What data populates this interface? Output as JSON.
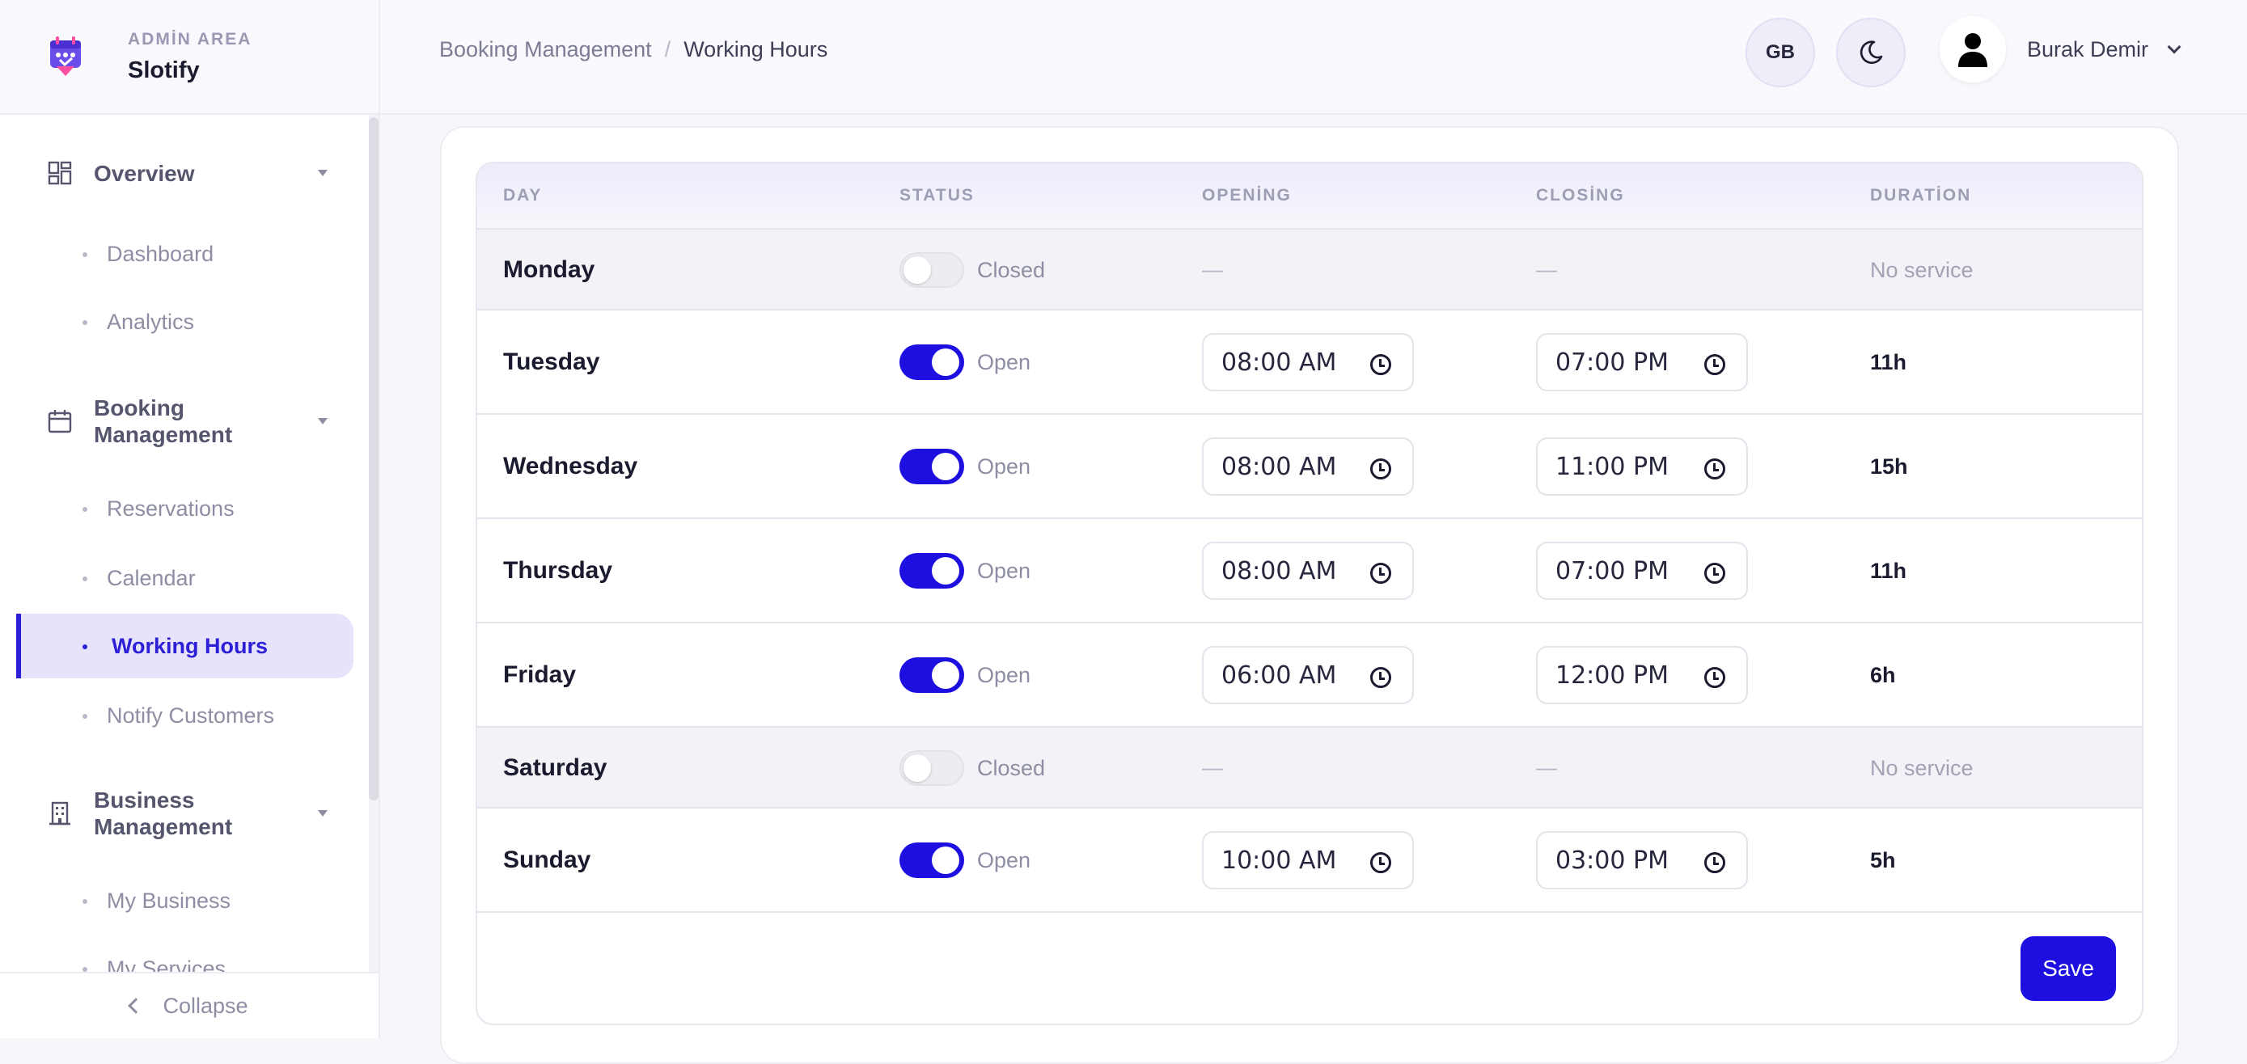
{
  "brand": {
    "area_label": "ADMİN AREA",
    "app_name": "Slotify"
  },
  "sidebar": {
    "groups": [
      {
        "label": "Overview",
        "items": [
          "Dashboard",
          "Analytics"
        ]
      },
      {
        "label": "Booking Management",
        "items": [
          "Reservations",
          "Calendar",
          "Working Hours",
          "Notify Customers"
        ]
      },
      {
        "label": "Business Management",
        "items": [
          "My Business",
          "My Services"
        ]
      }
    ],
    "active_item": "Working Hours",
    "collapse_label": "Collapse"
  },
  "header": {
    "breadcrumb": [
      "Booking Management",
      "Working Hours"
    ],
    "separator": "/",
    "language": "GB",
    "user_name": "Burak Demir"
  },
  "table": {
    "columns": [
      "DAY",
      "STATUS",
      "OPENİNG",
      "CLOSİNG",
      "DURATİON"
    ],
    "rows": [
      {
        "day": "Monday",
        "status": "Closed",
        "open": false,
        "opening": "—",
        "closing": "—",
        "duration": "No service"
      },
      {
        "day": "Tuesday",
        "status": "Open",
        "open": true,
        "opening": "08:00 AM",
        "closing": "07:00 PM",
        "duration": "11h"
      },
      {
        "day": "Wednesday",
        "status": "Open",
        "open": true,
        "opening": "08:00 AM",
        "closing": "11:00 PM",
        "duration": "15h"
      },
      {
        "day": "Thursday",
        "status": "Open",
        "open": true,
        "opening": "08:00 AM",
        "closing": "07:00 PM",
        "duration": "11h"
      },
      {
        "day": "Friday",
        "status": "Open",
        "open": true,
        "opening": "06:00 AM",
        "closing": "12:00 PM",
        "duration": "6h"
      },
      {
        "day": "Saturday",
        "status": "Closed",
        "open": false,
        "opening": "—",
        "closing": "—",
        "duration": "No service"
      },
      {
        "day": "Sunday",
        "status": "Open",
        "open": true,
        "opening": "10:00 AM",
        "closing": "03:00 PM",
        "duration": "5h"
      }
    ]
  },
  "actions": {
    "save_label": "Save"
  },
  "colors": {
    "accent": "#1d0fe0",
    "active_bg": "#e6e3fb",
    "muted": "#8d8ea3"
  }
}
